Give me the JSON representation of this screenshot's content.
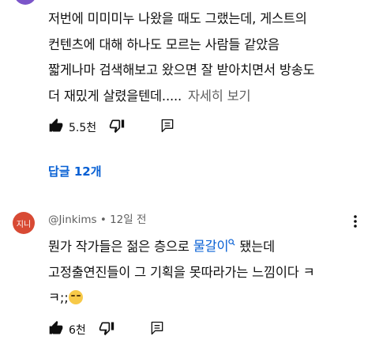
{
  "comment1": {
    "text_lines": [
      "저번에 미미미누 나왔을 때도 그랬는데, 게스트의",
      "컨텐츠에 대해 하나도 모르는 사람들 같았음",
      "짧게나마 검색해보고 왔으면 잘 받아치면서 방송도",
      "더 재밌게 살렸을텐데....."
    ],
    "read_more": "자세히 보기",
    "like_count": "5.5천"
  },
  "replies_link": "답글 12개",
  "comment2": {
    "avatar_text": "지니",
    "avatar_color": "#d84a34",
    "author": "@Jinkims",
    "separator": " • ",
    "time": "12일 전",
    "line1_before": "뭔가 작가들은 젊은 층으로 ",
    "line1_link": "물갈이",
    "line1_after": " 됐는데",
    "line2": "고정출연진들이 그 기획을 못따라가는 느낌이다 ㅋ",
    "line3": "ㅋ;;",
    "like_count": "6천"
  },
  "icons": [
    "thumbs-up-icon",
    "thumbs-down-icon",
    "reply-icon",
    "more-vert-icon",
    "search-icon",
    "laughing-emoji-icon"
  ],
  "colors": {
    "link": "#065fd4",
    "meta": "#606060",
    "text": "#0f0f0f"
  }
}
